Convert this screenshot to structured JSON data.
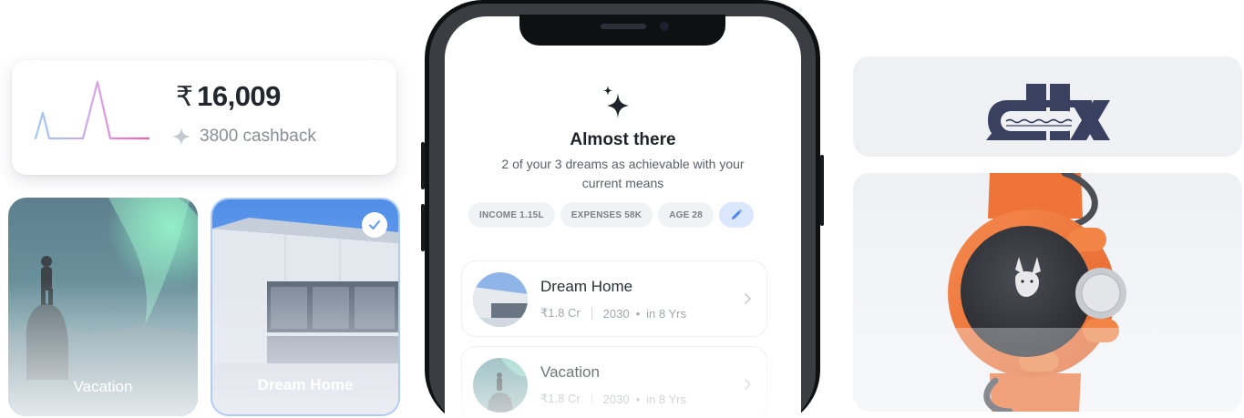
{
  "cashback_card": {
    "currency_symbol": "₹",
    "amount": "16,009",
    "cashback_text": "3800 cashback",
    "icon": "sparkle-icon"
  },
  "tiles": [
    {
      "label": "Vacation",
      "selected": false
    },
    {
      "label": "Dream Home",
      "selected": true,
      "badge_icon": "check-icon"
    }
  ],
  "phone": {
    "icon": "sparkles-icon",
    "title": "Almost there",
    "subtitle": "2 of your 3 dreams as achievable with your current means",
    "chips": [
      "INCOME 1.15L",
      "EXPENSES 58K",
      "AGE 28"
    ],
    "edit_icon": "pencil-icon",
    "dreams": [
      {
        "name": "Dream Home",
        "amount": "₹1.8 Cr",
        "year": "2030",
        "eta": "in 8 Yrs"
      },
      {
        "name": "Vacation",
        "amount": "₹1.8 Cr",
        "year": "2030",
        "eta": "in 8 Yrs"
      }
    ]
  },
  "colors": {
    "accent_blue": "#aecbfb",
    "pulse_start": "#9ec9f2",
    "pulse_end": "#f25ea0",
    "brand_navy": "#3a4060",
    "watch_orange": "#f2793a"
  }
}
